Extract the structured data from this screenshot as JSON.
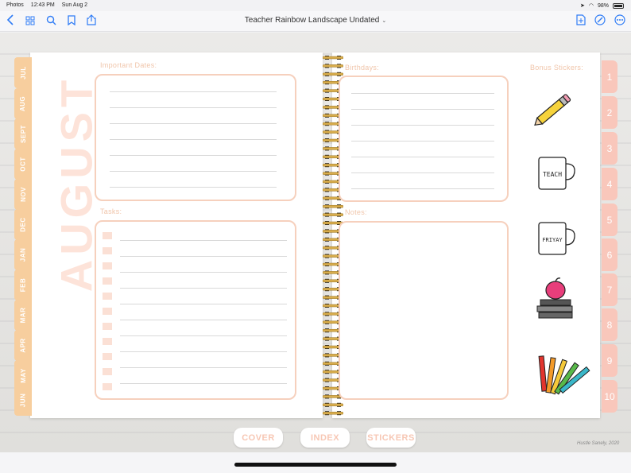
{
  "status_bar": {
    "app": "Photos",
    "time": "12:43 PM",
    "date": "Sun Aug 2",
    "battery": "98%"
  },
  "toolbar": {
    "title": "Teacher Rainbow Landscape Undated",
    "icons": [
      "back-icon",
      "grid-icon",
      "search-icon",
      "bookmark-icon",
      "share-icon",
      "add-page-icon",
      "pen-icon",
      "more-icon"
    ]
  },
  "planner": {
    "month_title": "AUGUST",
    "month_tabs": [
      "JUL",
      "AUG",
      "SEPT",
      "OCT",
      "NOV",
      "DEC",
      "JAN",
      "FEB",
      "MAR",
      "APR",
      "MAY",
      "JUN"
    ],
    "number_tabs": [
      "1",
      "2",
      "3",
      "4",
      "5",
      "6",
      "7",
      "8",
      "9",
      "10"
    ],
    "sections": {
      "important_dates": "Important Dates:",
      "tasks": "Tasks:",
      "birthdays": "Birthdays:",
      "notes": "Notes:",
      "bonus_stickers": "Bonus Stickers:"
    },
    "stickers": {
      "mug_teach": "TEACH",
      "mug_friday": "FRIYAY"
    }
  },
  "bottom_tabs": {
    "cover": "COVER",
    "index": "INDEX",
    "stickers": "STICKERS"
  },
  "credit": "Hustle Sanely, 2020",
  "colors": {
    "accent": "#2f7cf6",
    "month_tab": "#f7ce9e",
    "number_tab": "#f9c7bb",
    "box_border": "#f6d0bd"
  }
}
